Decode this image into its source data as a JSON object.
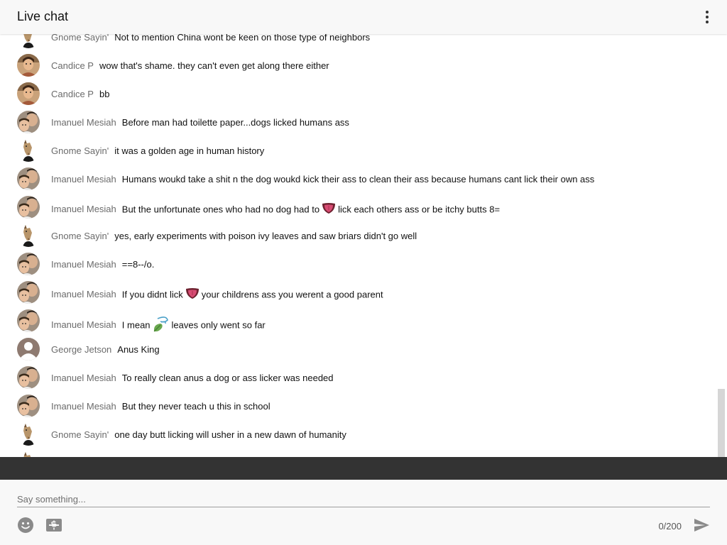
{
  "header": {
    "title": "Live chat",
    "menu_icon": "more-vert-icon"
  },
  "messages": [
    {
      "author": "Gnome Sayin'",
      "avatar": "horse-mask-avatar",
      "parts": [
        "Not to mention China wont be keen on those type of neighbors"
      ]
    },
    {
      "author": "Candice P",
      "avatar": "candice-photo-avatar",
      "parts": [
        "wow that's shame. they can't even get along there either"
      ]
    },
    {
      "author": "Candice P",
      "avatar": "candice-photo-avatar",
      "parts": [
        "bb"
      ]
    },
    {
      "author": "Imanuel Mesiah",
      "avatar": "imanuel-photo-avatar",
      "parts": [
        "Before man had toilette paper...dogs licked humans ass"
      ]
    },
    {
      "author": "Gnome Sayin'",
      "avatar": "horse-mask-avatar",
      "parts": [
        "it was a golden age in human history"
      ]
    },
    {
      "author": "Imanuel Mesiah",
      "avatar": "imanuel-photo-avatar",
      "parts": [
        "Humans woukd take a shit n the dog woukd kick their ass to clean their ass because humans cant lick their own ass"
      ]
    },
    {
      "author": "Imanuel Mesiah",
      "avatar": "imanuel-photo-avatar",
      "parts": [
        "But the unfortunate ones who had no dog had to",
        "lick each others ass or be itchy butts 8="
      ],
      "emoji": "tongue-emoji"
    },
    {
      "author": "Gnome Sayin'",
      "avatar": "horse-mask-avatar",
      "parts": [
        "yes, early experiments with poison ivy leaves and saw briars didn't go well"
      ]
    },
    {
      "author": "Imanuel Mesiah",
      "avatar": "imanuel-photo-avatar",
      "parts": [
        "==8--/o."
      ]
    },
    {
      "author": "Imanuel Mesiah",
      "avatar": "imanuel-photo-avatar",
      "parts": [
        "If you didnt lick",
        "your childrens ass you werent a good parent"
      ],
      "emoji": "tongue-emoji"
    },
    {
      "author": "Imanuel Mesiah",
      "avatar": "imanuel-photo-avatar",
      "parts": [
        "I mean",
        "leaves only went so far"
      ],
      "emoji": "leaf-wind-emoji"
    },
    {
      "author": "George Jetson",
      "avatar": "default-person-avatar",
      "parts": [
        "Anus King"
      ]
    },
    {
      "author": "Imanuel Mesiah",
      "avatar": "imanuel-photo-avatar",
      "parts": [
        "To really clean anus a dog or ass licker was needed"
      ]
    },
    {
      "author": "Imanuel Mesiah",
      "avatar": "imanuel-photo-avatar",
      "parts": [
        "But they never teach u this in school"
      ]
    },
    {
      "author": "Gnome Sayin'",
      "avatar": "horse-mask-avatar",
      "parts": [
        "one day butt licking will usher in a new dawn of humanity"
      ]
    }
  ],
  "composer": {
    "placeholder": "Say something...",
    "counter": "0/200",
    "emoji_button_icon": "smiley-icon",
    "super_chat_icon": "super-chat-dollar-icon",
    "send_icon": "send-icon"
  },
  "colors": {
    "header_bg": "#f8f8f8",
    "author_text": "#6b6b6b",
    "message_text": "#111111",
    "dark_bar": "#333333"
  }
}
